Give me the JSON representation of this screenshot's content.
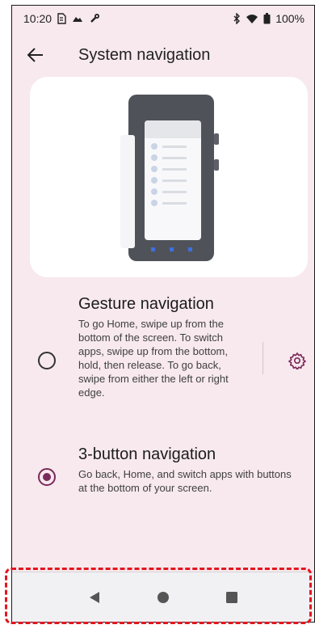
{
  "status": {
    "time": "10:20",
    "battery": "100%",
    "left_icons": [
      "sim-icon",
      "cloud-icon",
      "wrench-icon"
    ],
    "right_icons": [
      "bluetooth-icon",
      "wifi-icon",
      "battery-icon"
    ]
  },
  "header": {
    "title": "System navigation",
    "back_icon": "arrow-left-icon"
  },
  "options": [
    {
      "title": "Gesture navigation",
      "description": "To go Home, swipe up from the bottom of the screen. To switch apps, swipe up from the bottom, hold, then release. To go back, swipe from either the left or right edge.",
      "selected": false,
      "settings_icon": "gear-icon"
    },
    {
      "title": "3-button navigation",
      "description": "Go back, Home, and switch apps with buttons at the bottom of your screen.",
      "selected": true
    }
  ],
  "navbar": {
    "buttons": [
      "back-triangle-icon",
      "home-circle-icon",
      "recents-square-icon"
    ]
  },
  "colors": {
    "background": "#f7e9ee",
    "accent": "#7a2a5a",
    "highlight": "#e3161f"
  }
}
